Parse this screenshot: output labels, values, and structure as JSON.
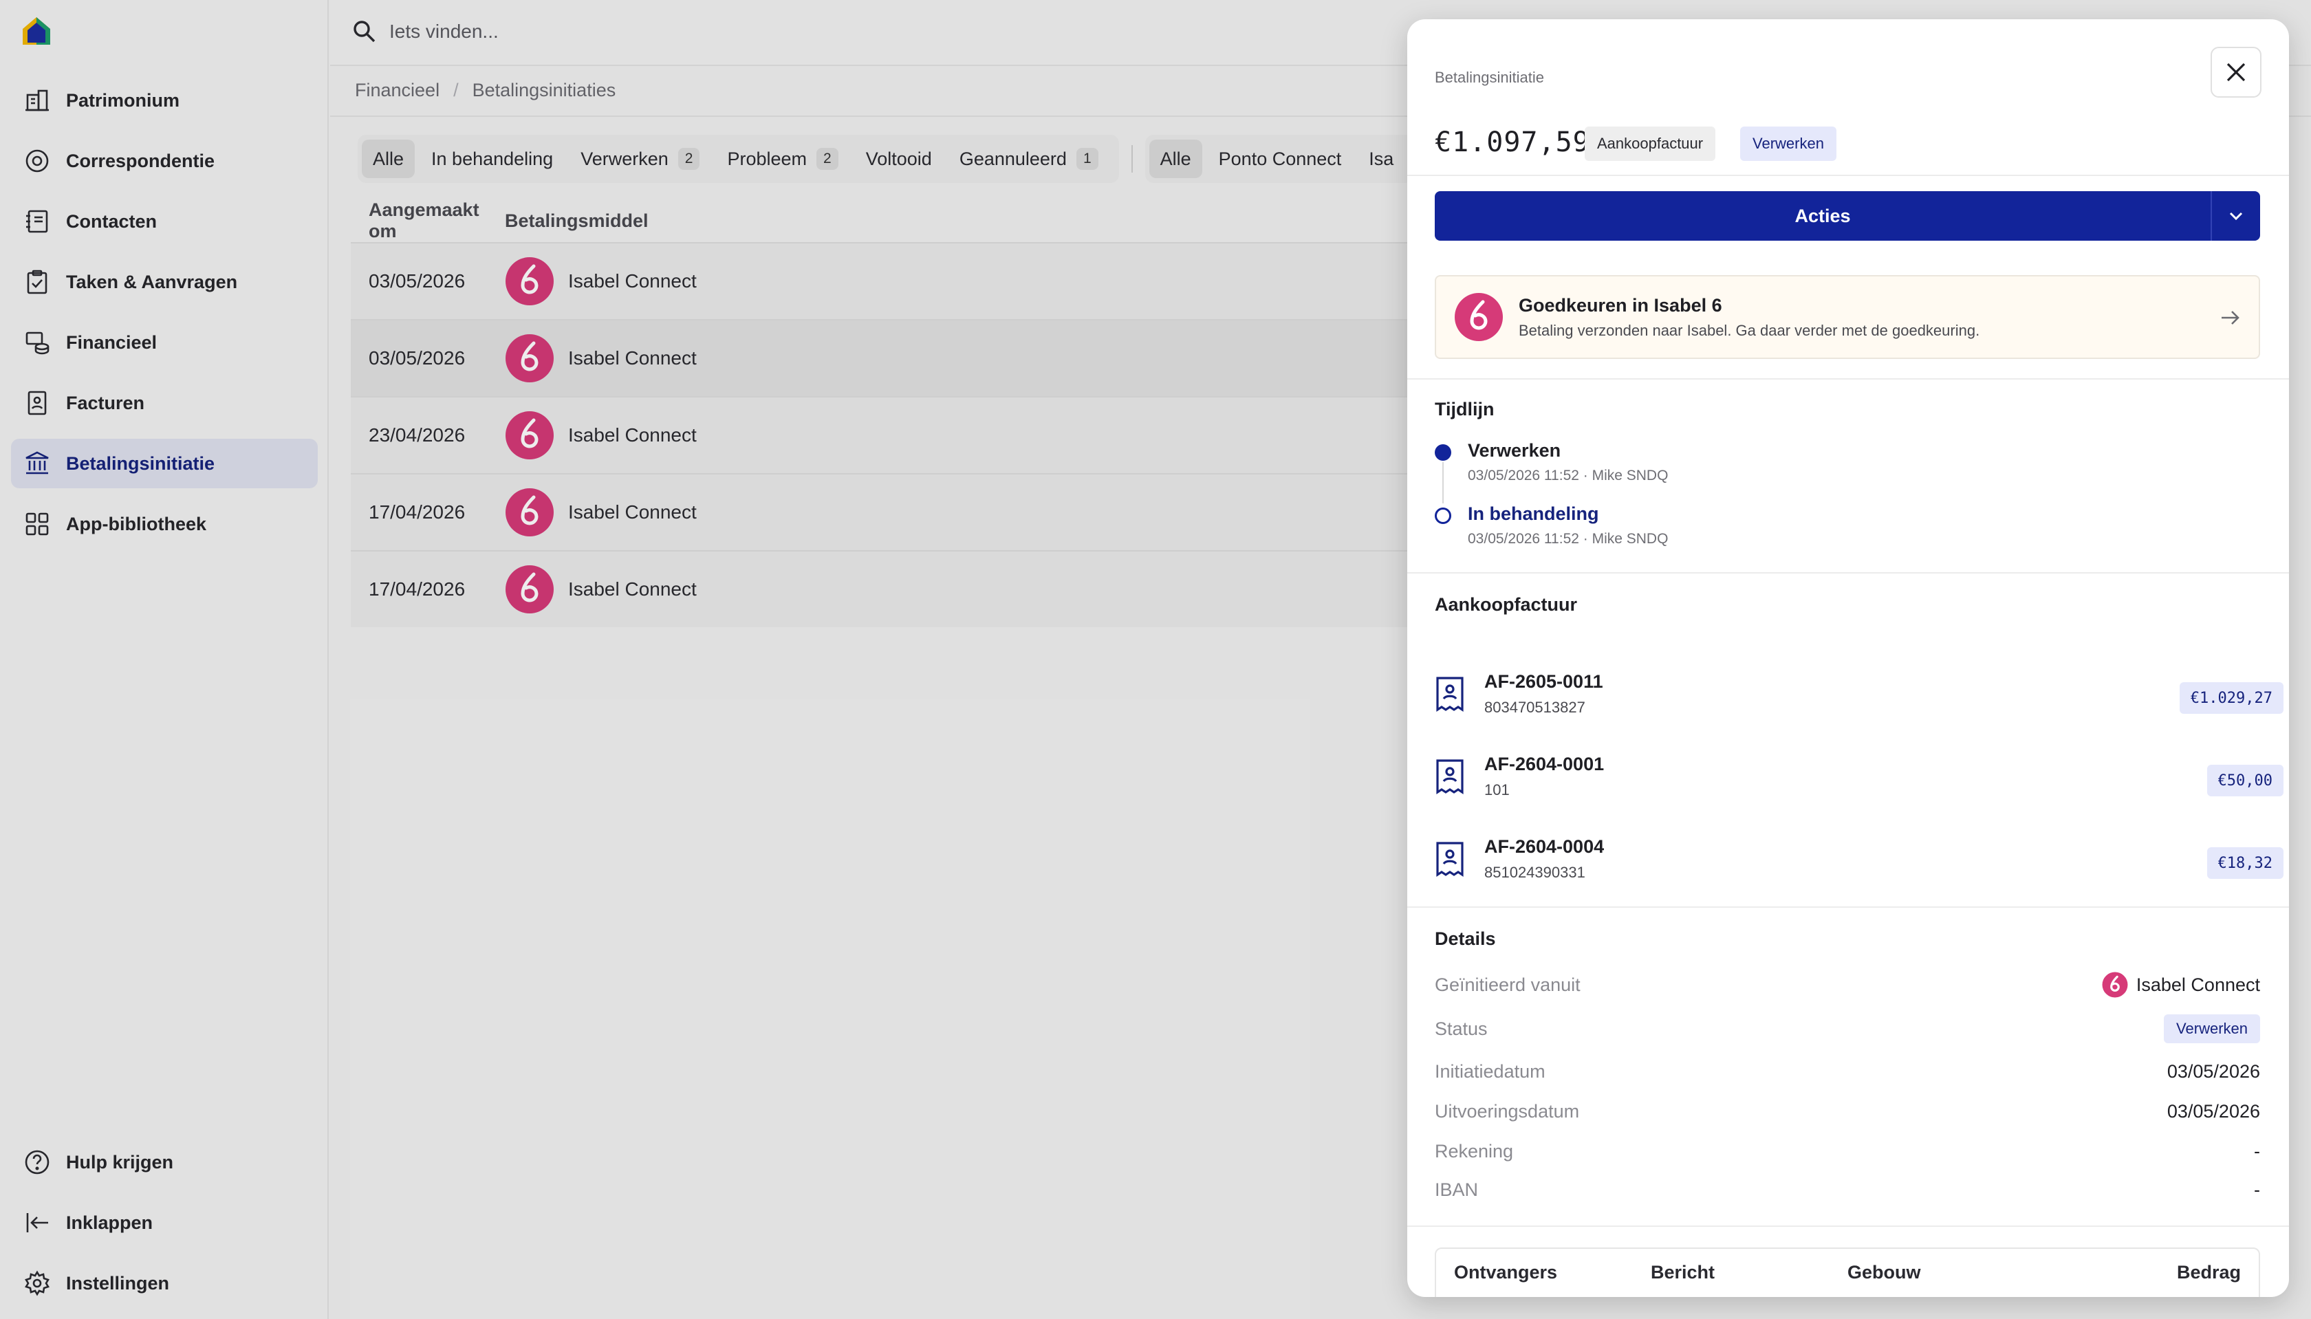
{
  "search": {
    "placeholder": "Iets vinden..."
  },
  "sidebar": {
    "items": [
      {
        "label": "Patrimonium"
      },
      {
        "label": "Correspondentie"
      },
      {
        "label": "Contacten"
      },
      {
        "label": "Taken & Aanvragen"
      },
      {
        "label": "Financieel"
      },
      {
        "label": "Facturen"
      },
      {
        "label": "Betalingsinitiatie",
        "active": true
      },
      {
        "label": "App-bibliotheek"
      }
    ],
    "bottom": [
      {
        "label": "Hulp krijgen"
      },
      {
        "label": "Inklappen"
      },
      {
        "label": "Instellingen"
      }
    ]
  },
  "breadcrumb": {
    "parent": "Financieel",
    "current": "Betalingsinitiaties"
  },
  "filters": {
    "status": [
      {
        "label": "Alle",
        "active": true
      },
      {
        "label": "In behandeling"
      },
      {
        "label": "Verwerken",
        "count": "2"
      },
      {
        "label": "Probleem",
        "count": "2"
      },
      {
        "label": "Voltooid"
      },
      {
        "label": "Geannuleerd",
        "count": "1"
      }
    ],
    "source": [
      {
        "label": "Alle",
        "active": true
      },
      {
        "label": "Ponto Connect"
      },
      {
        "label": "Isa"
      }
    ]
  },
  "table": {
    "columns": [
      "Aangemaakt om",
      "Betalingsmiddel"
    ],
    "rows": [
      {
        "date": "03/05/2026",
        "method": "Isabel Connect"
      },
      {
        "date": "03/05/2026",
        "method": "Isabel Connect",
        "selected": true
      },
      {
        "date": "23/04/2026",
        "method": "Isabel Connect"
      },
      {
        "date": "17/04/2026",
        "method": "Isabel Connect"
      },
      {
        "date": "17/04/2026",
        "method": "Isabel Connect"
      }
    ]
  },
  "drawer": {
    "kicker": "Betalingsinitiatie",
    "amount": "€1.097,59",
    "type_tag": "Aankoopfactuur",
    "status_tag": "Verwerken",
    "actions_label": "Acties",
    "callout": {
      "title": "Goedkeuren in Isabel 6",
      "subtitle": "Betaling verzonden naar Isabel. Ga daar verder met de goedkeuring."
    },
    "timeline_title": "Tijdlijn",
    "timeline": [
      {
        "title": "Verwerken",
        "meta": "03/05/2026 11:52 · Mike SNDQ"
      },
      {
        "title": "In behandeling",
        "meta": "03/05/2026 11:52 · Mike SNDQ"
      }
    ],
    "invoices_title": "Aankoopfactuur",
    "invoices": [
      {
        "number": "AF-2605-0011",
        "ref": "803470513827",
        "amount": "€1.029,27"
      },
      {
        "number": "AF-2604-0001",
        "ref": "101",
        "amount": "€50,00"
      },
      {
        "number": "AF-2604-0004",
        "ref": "851024390331",
        "amount": "€18,32"
      }
    ],
    "details_title": "Details",
    "details": {
      "initiated_from_label": "Geïnitieerd vanuit",
      "initiated_from_value": "Isabel Connect",
      "status_label": "Status",
      "status_value": "Verwerken",
      "initiation_date_label": "Initiatiedatum",
      "initiation_date_value": "03/05/2026",
      "execution_date_label": "Uitvoeringsdatum",
      "execution_date_value": "03/05/2026",
      "account_label": "Rekening",
      "account_value": "-",
      "iban_label": "IBAN",
      "iban_value": "-"
    },
    "recipients_columns": [
      "Ontvangers",
      "Bericht",
      "Gebouw",
      "Bedrag"
    ]
  },
  "colors": {
    "primary": "#12249a",
    "active_nav_bg": "#dfe1ee",
    "isabel_pink": "#d63a78",
    "badge_blue_bg": "#e5e8fb"
  }
}
